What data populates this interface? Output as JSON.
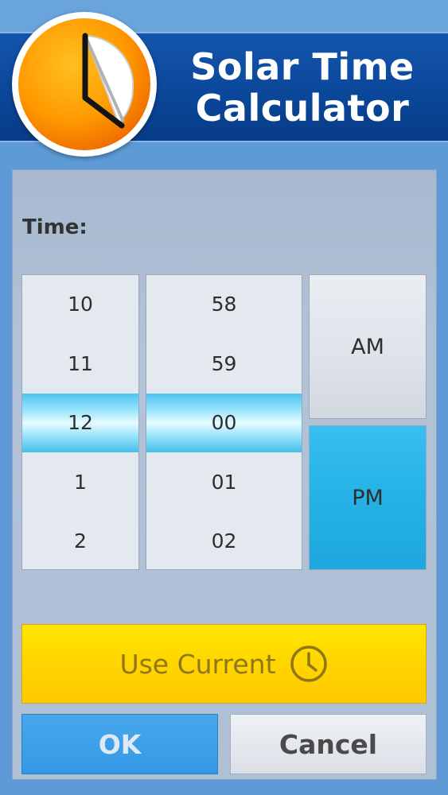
{
  "header": {
    "title_line1": "Solar Time",
    "title_line2": "Calculator",
    "logo_icon": "clock-icon"
  },
  "time_label": "Time:",
  "hour_picker": {
    "items": [
      "10",
      "11",
      "12",
      "1",
      "2"
    ],
    "selected": "12"
  },
  "minute_picker": {
    "items": [
      "58",
      "59",
      "00",
      "01",
      "02"
    ],
    "selected": "00"
  },
  "ampm": {
    "am_label": "AM",
    "pm_label": "PM",
    "selected": "PM"
  },
  "use_current": {
    "label": "Use Current",
    "icon": "clock-icon"
  },
  "buttons": {
    "ok_label": "OK",
    "cancel_label": "Cancel"
  },
  "colors": {
    "header_blue": "#0a4698",
    "accent_cyan": "#25b2e6",
    "use_current_yellow": "#ffd500",
    "ok_blue": "#3a9fe8"
  }
}
